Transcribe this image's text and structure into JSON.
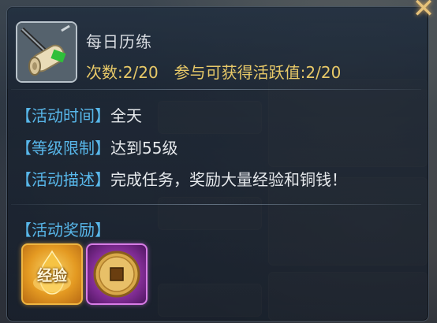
{
  "activity": {
    "title": "每日历练",
    "count_label": "次数:",
    "count_value": "2/20",
    "active_label": "参与可获得活跃值:",
    "active_value": "2/20"
  },
  "details": [
    {
      "key": "【活动时间】",
      "value": "全天"
    },
    {
      "key": "【等级限制】",
      "value": "达到55级"
    },
    {
      "key": "【活动描述】",
      "value": "完成任务，奖励大量经验和铜钱！"
    }
  ],
  "rewards": {
    "header": "【活动奖励】",
    "items": [
      {
        "label": "经验",
        "icon": "exp-orb-icon"
      },
      {
        "icon": "copper-coin-icon"
      }
    ]
  },
  "icons": {
    "close": "close-icon",
    "activity": "scroll-sword-icon"
  },
  "colors": {
    "key_blue": "#58b7ea",
    "value_gold": "#e8c968",
    "text_light": "#e6e9ec",
    "exp_border": "#f0b640",
    "coin_border": "#d87ce6"
  }
}
